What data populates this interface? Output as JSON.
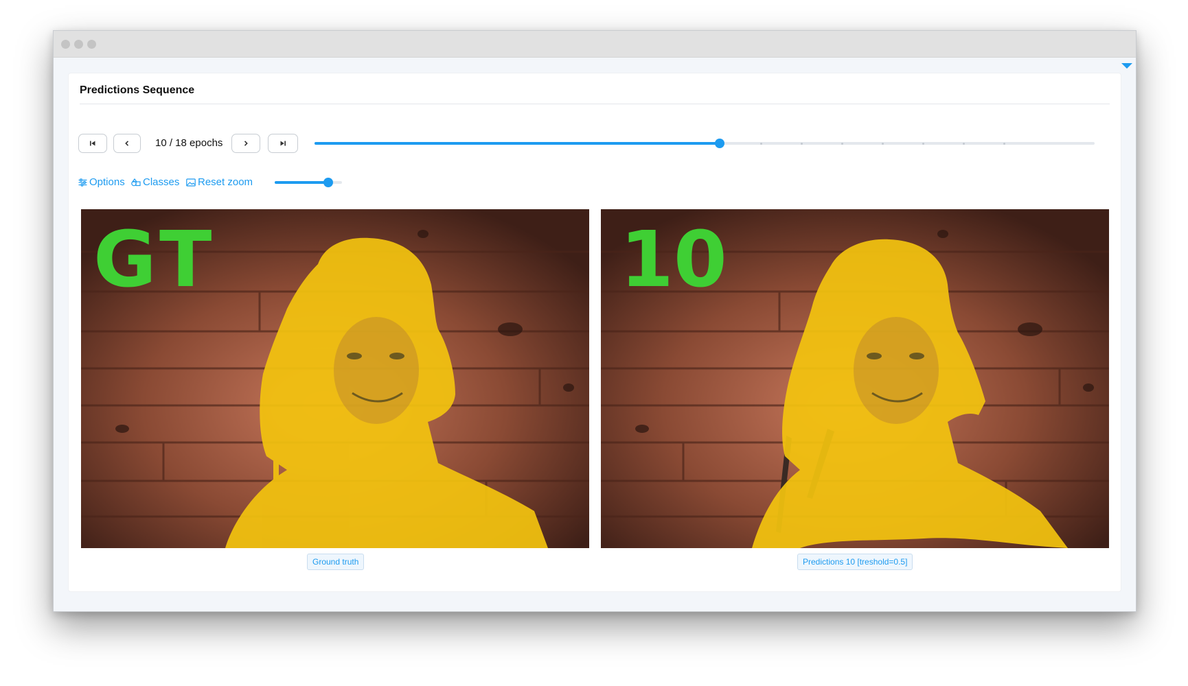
{
  "panel": {
    "title": "Predictions Sequence"
  },
  "navigation": {
    "first_icon": "skip-to-first-icon",
    "prev_icon": "chevron-left-icon",
    "next_icon": "chevron-right-icon",
    "last_icon": "skip-to-last-icon",
    "epoch_label": "10 / 18 epochs",
    "current_epoch": 10,
    "total_epochs": 18
  },
  "toolbar": {
    "options_label": "Options",
    "classes_label": "Classes",
    "reset_zoom_label": "Reset zoom",
    "zoom_level": 0.8
  },
  "figures": {
    "left": {
      "overlay_text": "GT",
      "caption": "Ground truth"
    },
    "right": {
      "overlay_text": "10",
      "caption": "Predictions 10 [treshold=0.5]"
    }
  },
  "colors": {
    "accent": "#1d9bf0",
    "mask": "#f3c30f",
    "annotation": "#3fcf34",
    "wood": "#8a4a34"
  }
}
